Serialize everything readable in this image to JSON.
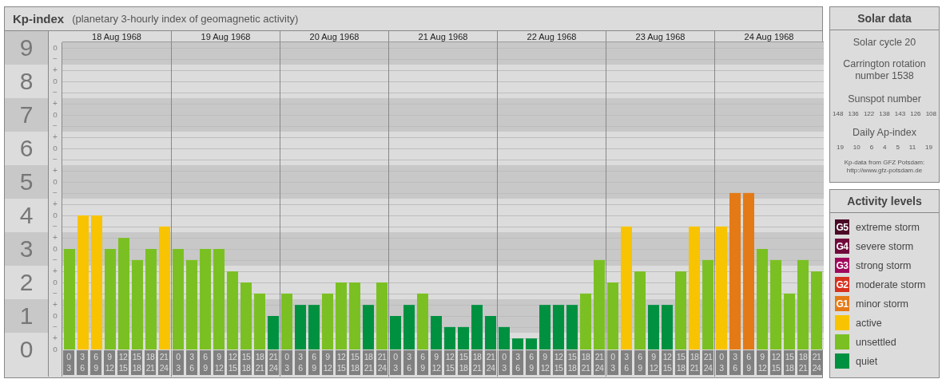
{
  "chart_panel": {
    "subtitle": "(planetary 3-hourly index of geomagnetic activity)",
    "sub_ticks": [
      "o",
      "−",
      "+",
      "o",
      "−",
      "+",
      "o",
      "−",
      "+",
      "o",
      "−",
      "+",
      "o",
      "−",
      "+",
      "o",
      "−",
      "+",
      "o",
      "−",
      "+",
      "o",
      "−",
      "+",
      "o",
      "−",
      "+",
      "o"
    ],
    "days": [
      {
        "date": "18 Aug 1968",
        "bins": [
          {
            "from": "0",
            "to": "3"
          },
          {
            "from": "3",
            "to": "6"
          },
          {
            "from": "6",
            "to": "9"
          },
          {
            "from": "9",
            "to": "12"
          },
          {
            "from": "12",
            "to": "15"
          },
          {
            "from": "15",
            "to": "18"
          },
          {
            "from": "18",
            "to": "21"
          },
          {
            "from": "21",
            "to": "24"
          }
        ]
      },
      {
        "date": "19 Aug 1968",
        "bins": [
          {
            "from": "0",
            "to": "3"
          },
          {
            "from": "3",
            "to": "6"
          },
          {
            "from": "6",
            "to": "9"
          },
          {
            "from": "9",
            "to": "12"
          },
          {
            "from": "12",
            "to": "15"
          },
          {
            "from": "15",
            "to": "18"
          },
          {
            "from": "18",
            "to": "21"
          },
          {
            "from": "21",
            "to": "24"
          }
        ]
      },
      {
        "date": "20 Aug 1968",
        "bins": [
          {
            "from": "0",
            "to": "3"
          },
          {
            "from": "3",
            "to": "6"
          },
          {
            "from": "6",
            "to": "9"
          },
          {
            "from": "9",
            "to": "12"
          },
          {
            "from": "12",
            "to": "15"
          },
          {
            "from": "15",
            "to": "18"
          },
          {
            "from": "18",
            "to": "21"
          },
          {
            "from": "21",
            "to": "24"
          }
        ]
      },
      {
        "date": "21 Aug 1968",
        "bins": [
          {
            "from": "0",
            "to": "3"
          },
          {
            "from": "3",
            "to": "6"
          },
          {
            "from": "6",
            "to": "9"
          },
          {
            "from": "9",
            "to": "12"
          },
          {
            "from": "12",
            "to": "15"
          },
          {
            "from": "15",
            "to": "18"
          },
          {
            "from": "18",
            "to": "21"
          },
          {
            "from": "21",
            "to": "24"
          }
        ]
      },
      {
        "date": "22 Aug 1968",
        "bins": [
          {
            "from": "0",
            "to": "3"
          },
          {
            "from": "3",
            "to": "6"
          },
          {
            "from": "6",
            "to": "9"
          },
          {
            "from": "9",
            "to": "12"
          },
          {
            "from": "12",
            "to": "15"
          },
          {
            "from": "15",
            "to": "18"
          },
          {
            "from": "18",
            "to": "21"
          },
          {
            "from": "21",
            "to": "24"
          }
        ]
      },
      {
        "date": "23 Aug 1968",
        "bins": [
          {
            "from": "0",
            "to": "3"
          },
          {
            "from": "3",
            "to": "6"
          },
          {
            "from": "6",
            "to": "9"
          },
          {
            "from": "9",
            "to": "12"
          },
          {
            "from": "12",
            "to": "15"
          },
          {
            "from": "15",
            "to": "18"
          },
          {
            "from": "18",
            "to": "21"
          },
          {
            "from": "21",
            "to": "24"
          }
        ]
      },
      {
        "date": "24 Aug 1968",
        "bins": [
          {
            "from": "0",
            "to": "3"
          },
          {
            "from": "3",
            "to": "6"
          },
          {
            "from": "6",
            "to": "9"
          },
          {
            "from": "9",
            "to": "12"
          },
          {
            "from": "12",
            "to": "15"
          },
          {
            "from": "15",
            "to": "18"
          },
          {
            "from": "18",
            "to": "21"
          },
          {
            "from": "21",
            "to": "24"
          }
        ]
      }
    ],
    "chart_data": {
      "type": "bar",
      "title": "Kp-index",
      "grid": true,
      "ylim": [
        0,
        9
      ],
      "yticks": [
        {
          "value": 0,
          "label": "0"
        },
        {
          "value": 1,
          "label": "1"
        },
        {
          "value": 2,
          "label": "2"
        },
        {
          "value": 3,
          "label": "3"
        },
        {
          "value": 4,
          "label": "4"
        },
        {
          "value": 5,
          "label": "5"
        },
        {
          "value": 6,
          "label": "6"
        },
        {
          "value": 7,
          "label": "7"
        },
        {
          "value": 8,
          "label": "8"
        },
        {
          "value": 9,
          "label": "9"
        }
      ],
      "values": [
        3,
        4,
        4,
        3,
        3.33,
        2.67,
        3,
        3.67,
        3,
        2.67,
        3,
        3,
        2.33,
        2,
        1.67,
        1,
        1.67,
        1.33,
        1.33,
        1.67,
        2,
        2,
        1.33,
        2,
        1,
        1.33,
        1.67,
        1,
        0.67,
        0.67,
        1.33,
        1,
        0.67,
        0.33,
        0.33,
        1.33,
        1.33,
        1.33,
        1.67,
        2.67,
        2,
        3.67,
        2.33,
        1.33,
        1.33,
        2.33,
        3.67,
        2.67,
        3.67,
        4.67,
        4.67,
        3,
        2.67,
        1.67,
        2.67,
        2.33
      ]
    }
  },
  "solar_data": {
    "title": "Solar data",
    "solar_cycle": "Solar cycle 20",
    "carrington": "Carrington rotation number 1538",
    "sunspot_label": "Sunspot number",
    "sunspot_numbers": [
      "148",
      "136",
      "122",
      "138",
      "143",
      "126",
      "108"
    ],
    "ap_label": "Daily Ap-index",
    "ap_values": [
      "19",
      "10",
      "6",
      "4",
      "5",
      "11",
      "19"
    ],
    "source": "Kp-data from GFZ Potsdam:",
    "source_url": "http://www.gfz-potsdam.de"
  },
  "activity_levels": {
    "title": "Activity levels",
    "items": [
      {
        "badge": "G5",
        "label": "extreme storm",
        "color": "#4a0a26"
      },
      {
        "badge": "G4",
        "label": "severe storm",
        "color": "#700a3c"
      },
      {
        "badge": "G3",
        "label": "strong storm",
        "color": "#a0085c"
      },
      {
        "badge": "G2",
        "label": "moderate storm",
        "color": "#d8301e"
      },
      {
        "badge": "G1",
        "label": "minor storm",
        "color": "#e47a16"
      },
      {
        "label": "active",
        "color": "#f8c300"
      },
      {
        "label": "unsettled",
        "color": "#7bc022"
      },
      {
        "label": "quiet",
        "color": "#009140"
      }
    ]
  }
}
